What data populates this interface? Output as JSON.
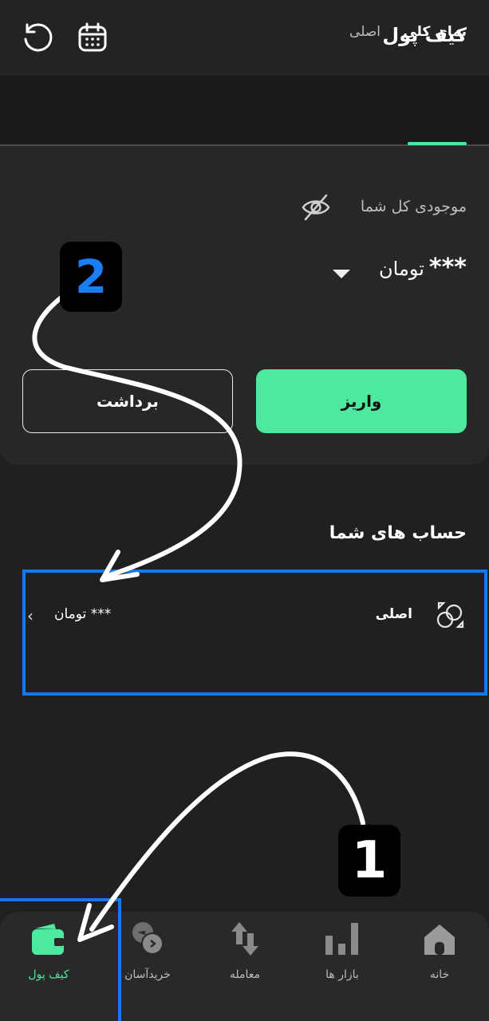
{
  "header": {
    "title": "کیف پول",
    "calendar_icon": "calendar-icon",
    "refresh_icon": "refresh-icon"
  },
  "tabs": [
    {
      "label": "نمای کلی",
      "active": true
    },
    {
      "label": "اصلی",
      "active": false
    }
  ],
  "balance": {
    "label": "موجودی کل شما",
    "amount": "***",
    "unit": "تومان"
  },
  "actions": {
    "deposit_label": "واریز",
    "withdraw_label": "برداشت"
  },
  "accounts": {
    "title": "حساب های شما",
    "items": [
      {
        "name": "اصلی",
        "amount": "*** تومان"
      }
    ]
  },
  "bottom_nav": [
    {
      "label": "خانه",
      "icon": "home-icon"
    },
    {
      "label": "بازار ها",
      "icon": "bar-chart-icon"
    },
    {
      "label": "معامله",
      "icon": "swap-arrows-icon"
    },
    {
      "label": "خریدآسان",
      "icon": "coins-icon"
    },
    {
      "label": "کیف پول",
      "icon": "wallet-icon",
      "active": true
    }
  ],
  "annotations": {
    "step_1": "1",
    "step_2": "2"
  },
  "colors": {
    "accent": "#4ce99e",
    "highlight": "#1279f0",
    "background": "#202020"
  }
}
